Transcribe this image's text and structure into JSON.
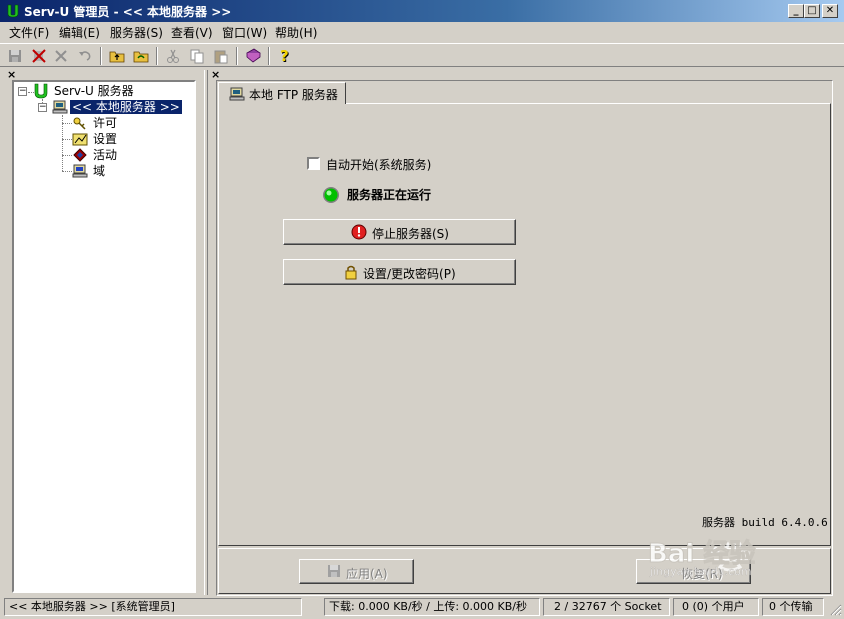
{
  "window": {
    "title": "Serv-U 管理员 - << 本地服务器 >>",
    "min_glyph": "_",
    "max_glyph": "□",
    "close_glyph": "✕"
  },
  "menu": [
    {
      "label": "文件(F)"
    },
    {
      "label": "编辑(E)"
    },
    {
      "label": "服务器(S)"
    },
    {
      "label": "查看(V)"
    },
    {
      "label": "窗口(W)"
    },
    {
      "label": "帮助(H)"
    }
  ],
  "toolbar": {
    "icons": [
      "save-icon",
      "disconnect-icon",
      "delete-icon",
      "undo-icon",
      "up-folder-icon",
      "refresh-icon",
      "cut-icon",
      "copy-icon",
      "paste-icon",
      "book-icon",
      "help-icon"
    ]
  },
  "panes": {
    "left_close": "×",
    "right_close": "×"
  },
  "tree": {
    "root": {
      "label": "Serv-U 服务器",
      "expander": "−"
    },
    "server": {
      "label": "<< 本地服务器 >>",
      "expander": "−"
    },
    "children": [
      {
        "label": "许可",
        "icon": "key-icon"
      },
      {
        "label": "设置",
        "icon": "settings-chart-icon"
      },
      {
        "label": "活动",
        "icon": "activity-icon"
      },
      {
        "label": "域",
        "icon": "domain-computer-icon"
      }
    ]
  },
  "tab": {
    "label": "本地 FTP 服务器"
  },
  "server_panel": {
    "autostart_label": "自动开始(系统服务)",
    "autostart_checked": false,
    "status_text": "服务器正在运行",
    "status_color": "#00c000",
    "stop_button": "停止服务器(S)",
    "password_button": "设置/更改密码(P)",
    "build_text": "服务器 build 6.4.0.6"
  },
  "bottom_buttons": {
    "apply": "应用(A)",
    "reset": "恢复(R)"
  },
  "statusbar": {
    "server": "<< 本地服务器 >> [系统管理员]",
    "transfer_rate": "下载: 0.000 KB/秒 / 上传: 0.000 KB/秒",
    "sockets": "2 / 32767 个 Socket",
    "users": "0 (0) 个用户",
    "transfers": "0 个传输"
  },
  "watermark": {
    "text": "Bai 经验",
    "url": "jingyan.baidu.com"
  }
}
